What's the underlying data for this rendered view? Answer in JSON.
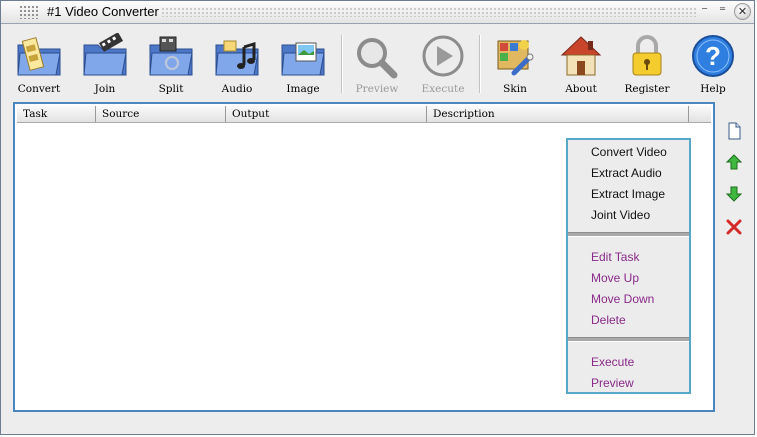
{
  "window": {
    "title": "#1 Video Converter"
  },
  "toolbar": [
    {
      "label": "Convert",
      "icon": "convert-folder-film-icon"
    },
    {
      "label": "Join",
      "icon": "join-folder-icon"
    },
    {
      "label": "Split",
      "icon": "split-folder-icon"
    },
    {
      "label": "Audio",
      "icon": "audio-folder-icon"
    },
    {
      "label": "Image",
      "icon": "image-folder-icon"
    },
    {
      "label": "Preview",
      "icon": "magnifier-icon",
      "disabled": true
    },
    {
      "label": "Execute",
      "icon": "play-icon",
      "disabled": true
    },
    {
      "label": "Skin",
      "icon": "skin-icon"
    },
    {
      "label": "About",
      "icon": "house-icon"
    },
    {
      "label": "Register",
      "icon": "padlock-icon"
    },
    {
      "label": "Help",
      "icon": "help-icon"
    }
  ],
  "table": {
    "columns": [
      "Task",
      "Source",
      "Output",
      "Description"
    ]
  },
  "context_menu": {
    "group1": [
      "Convert Video",
      "Extract Audio",
      "Extract Image",
      "Joint Video"
    ],
    "group2": [
      "Edit Task",
      "Move Up",
      "Move Down",
      "Delete"
    ],
    "group3": [
      "Execute",
      "Preview"
    ]
  },
  "side_buttons": [
    "new-task-icon",
    "move-up-arrow-icon",
    "move-down-arrow-icon",
    "delete-x-icon"
  ],
  "colors": {
    "panel_border": "#4a86bf",
    "menu_border": "#58a7c9",
    "menu_item_purple": "#8a2a8a"
  }
}
